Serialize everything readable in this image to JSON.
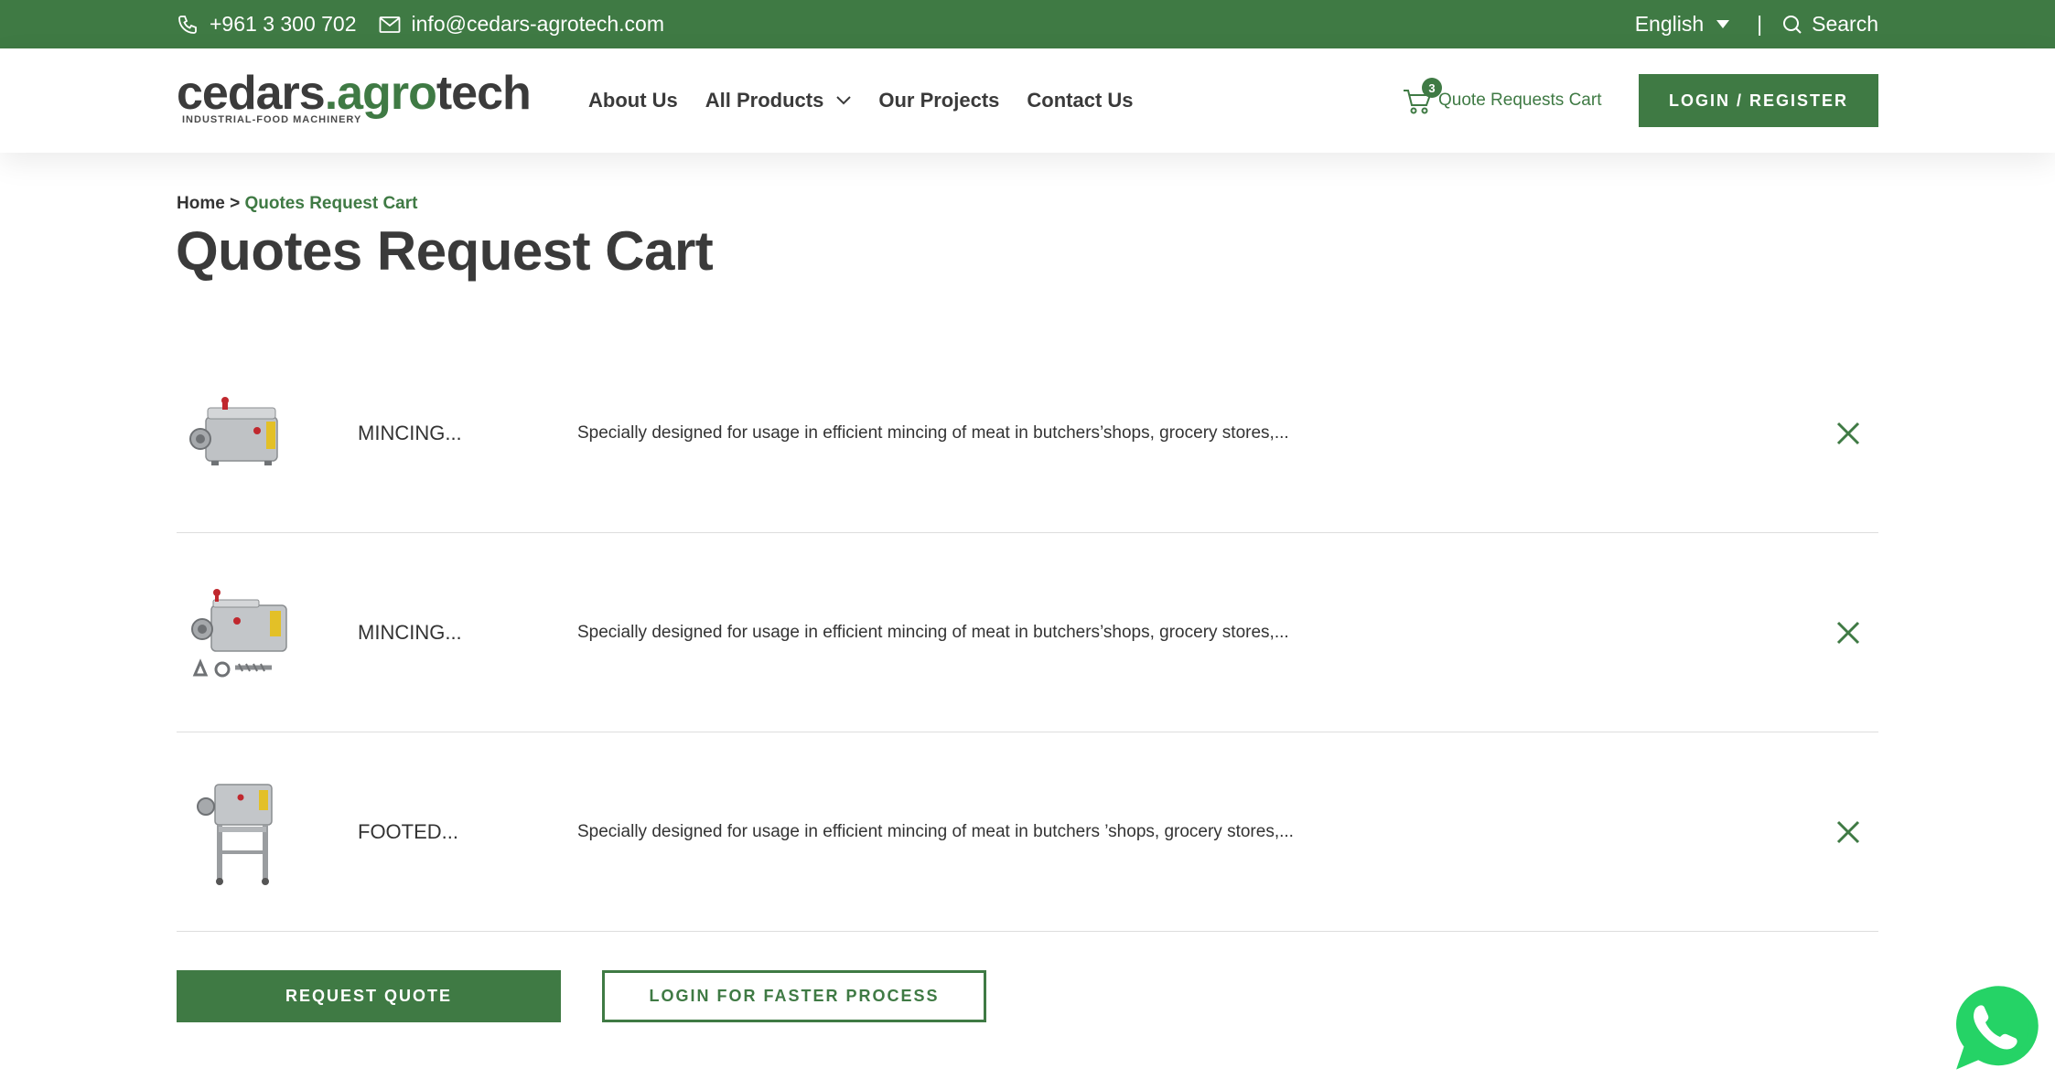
{
  "topbar": {
    "phone": "+961 3 300 702",
    "email": "info@cedars-agrotech.com",
    "language": "English",
    "separator": "|",
    "search_label": "Search",
    "icons": {
      "phone": "phone-icon",
      "email": "mail-icon",
      "language": "caret-down-icon",
      "search": "search-icon"
    }
  },
  "header": {
    "logo": {
      "part1": "cedars",
      "part2": ".agr",
      "part3": "o",
      "part4": "tech",
      "tagline": "INDUSTRIAL-FOOD MACHINERY"
    },
    "nav": [
      {
        "label": "About Us"
      },
      {
        "label": "All Products"
      },
      {
        "label": "Our Projects"
      },
      {
        "label": "Contact Us"
      }
    ],
    "cart": {
      "count": "3",
      "label": "Quote Requests Cart"
    },
    "login_label": "LOGIN / REGISTER"
  },
  "breadcrumb": {
    "home": "Home",
    "separator": ">",
    "current": "Quotes Request Cart"
  },
  "page_title": "Quotes Request Cart",
  "items": [
    {
      "name": "MINCING...",
      "description": "Specially designed for usage in efficient mincing of meat in butchers’shops, grocery stores,..."
    },
    {
      "name": "MINCING...",
      "description": "Specially designed for usage in efficient mincing of meat in butchers’shops, grocery stores,..."
    },
    {
      "name": "FOOTED...",
      "description": "Specially designed for usage in efficient mincing of meat in butchers ’shops, grocery stores,..."
    }
  ],
  "actions": {
    "request_quote": "REQUEST QUOTE",
    "login_faster": "LOGIN FOR FASTER PROCESS"
  },
  "colors": {
    "brand_green": "#3f7a44",
    "text_dark": "#3a3a3a",
    "whatsapp_green": "#25d366"
  }
}
